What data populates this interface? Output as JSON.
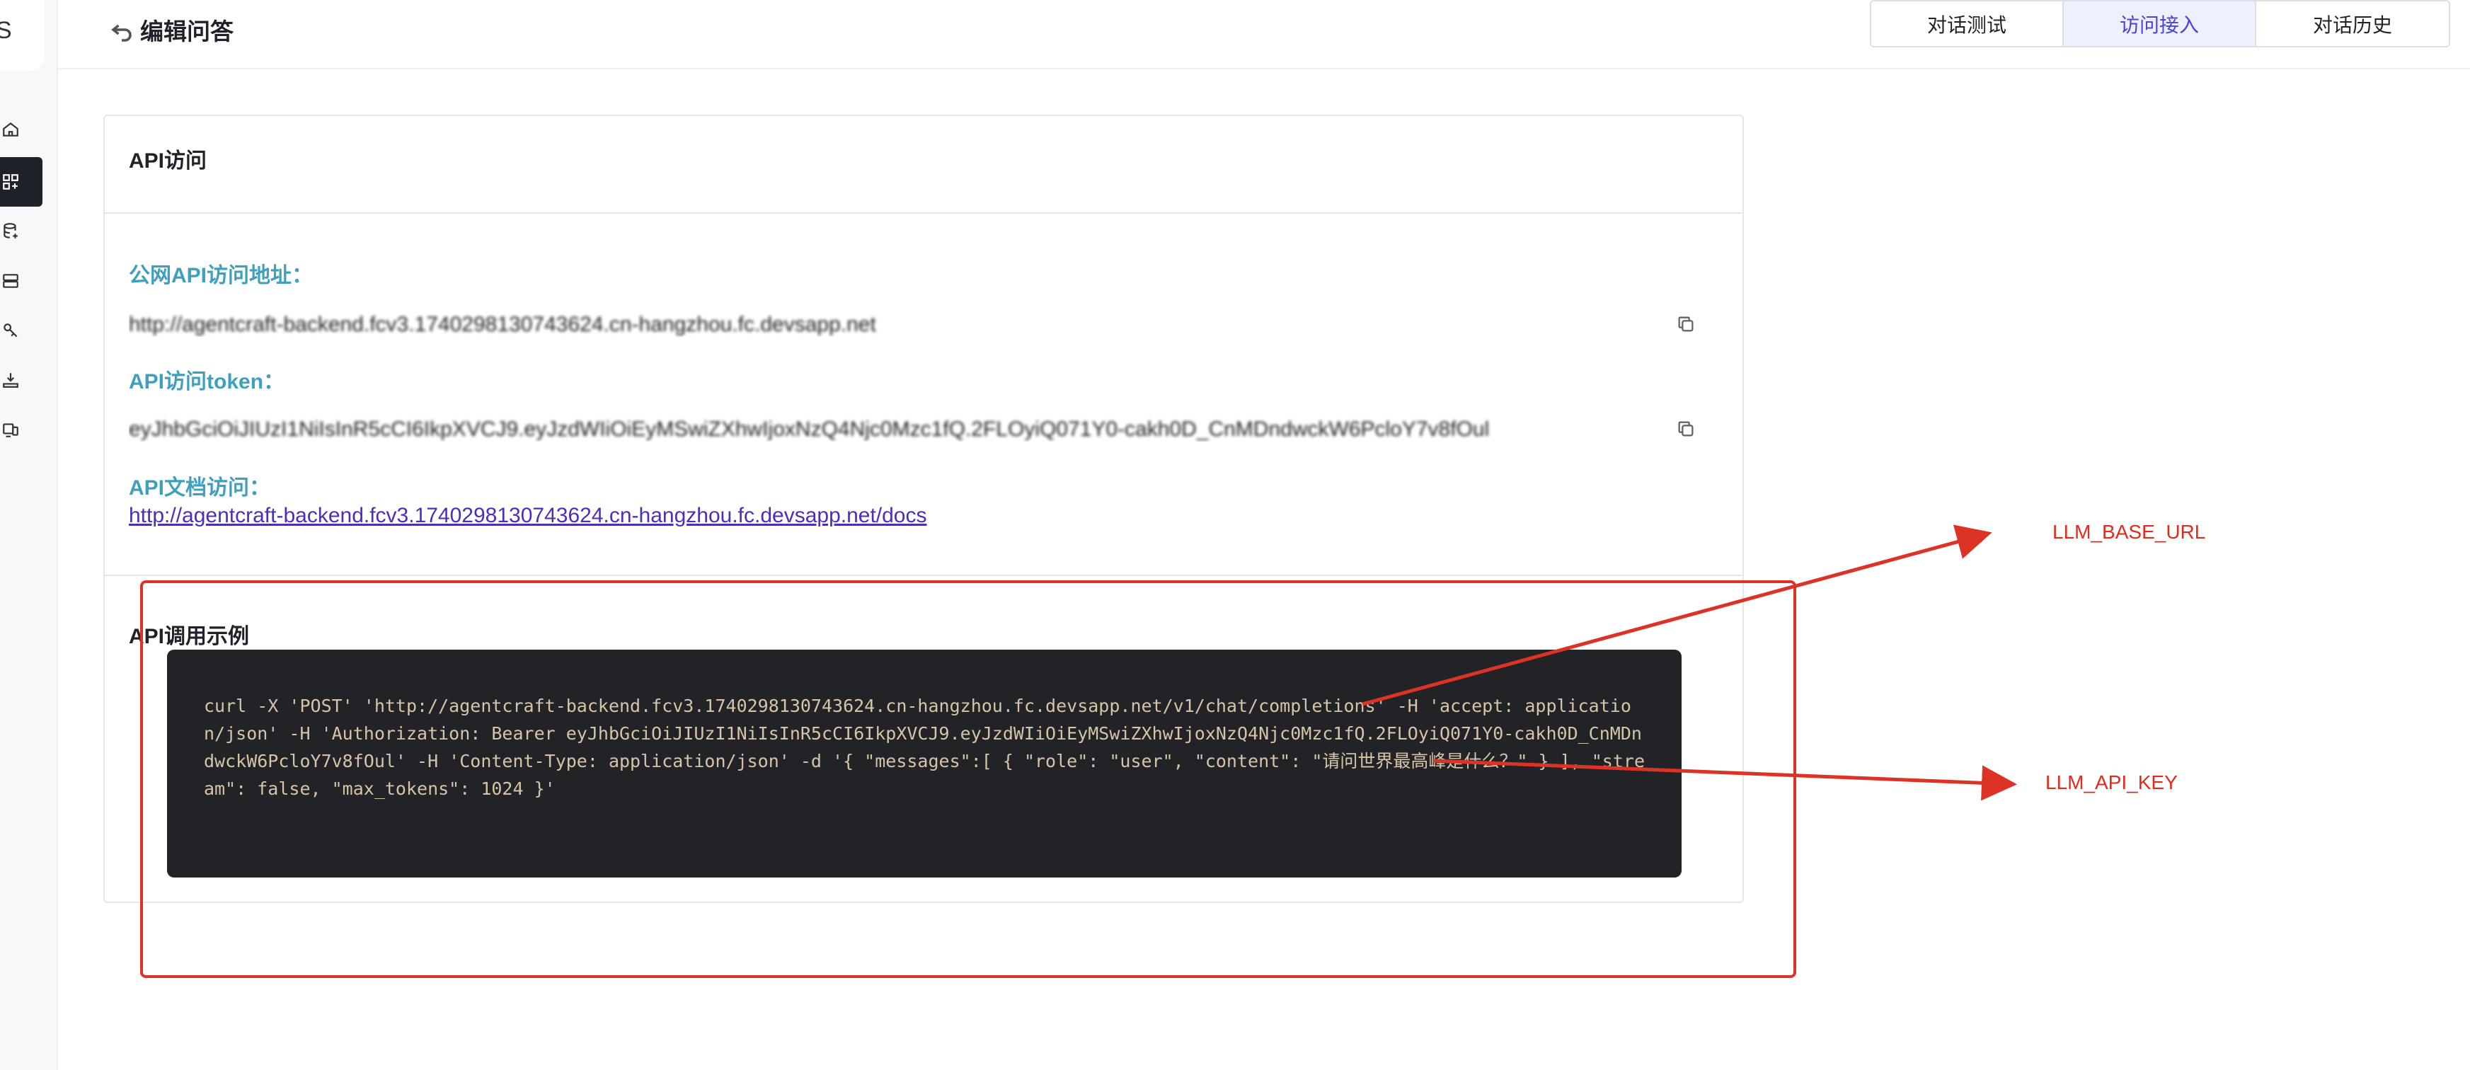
{
  "header": {
    "title": "编辑问答",
    "tabs": [
      {
        "label": "对话测试",
        "active": false
      },
      {
        "label": "访问接入",
        "active": true
      },
      {
        "label": "对话历史",
        "active": false
      }
    ]
  },
  "sidebar": {
    "logo_glyph": "S",
    "icons": [
      "home-icon",
      "apps-icon",
      "database-icon",
      "server-icon",
      "tools-icon",
      "deploy-icon",
      "devices-icon"
    ],
    "active_index": 1
  },
  "api_access": {
    "title": "API访问",
    "url_label": "公网API访问地址：",
    "url_value": "http://agentcraft-backend.fcv3.1740298130743624.cn-hangzhou.fc.devsapp.net",
    "token_label": "API访问token：",
    "token_value": "eyJhbGciOiJIUzI1NiIsInR5cCI6IkpXVCJ9.eyJzdWIiOiEyMSwiZXhwIjoxNzQ4Njc0Mzc1fQ.2FLOyiQ071Y0-cakh0D_CnMDndwckW6PcloY7v8fOul",
    "docs_label": "API文档访问：",
    "docs_link": "http://agentcraft-backend.fcv3.1740298130743624.cn-hangzhou.fc.devsapp.net/docs"
  },
  "example": {
    "title": "API调用示例",
    "code": "curl -X 'POST' 'http://agentcraft-backend.fcv3.1740298130743624.cn-hangzhou.fc.devsapp.net/v1/chat/completions' -H 'accept: application/json' -H 'Authorization: Bearer eyJhbGciOiJIUzI1NiIsInR5cCI6IkpXVCJ9.eyJzdWIiOiEyMSwiZXhwIjoxNzQ4Njc0Mzc1fQ.2FLOyiQ071Y0-cakh0D_CnMDndwckW6PcloY7v8fOul' -H 'Content-Type: application/json' -d '{ \"messages\":[ { \"role\": \"user\", \"content\": \"请问世界最高峰是什么？\" } ], \"stream\": false, \"max_tokens\": 1024 }'"
  },
  "annotations": {
    "base_url_label": "LLM_BASE_URL",
    "api_key_label": "LLM_API_KEY",
    "color": "#dd3326"
  }
}
